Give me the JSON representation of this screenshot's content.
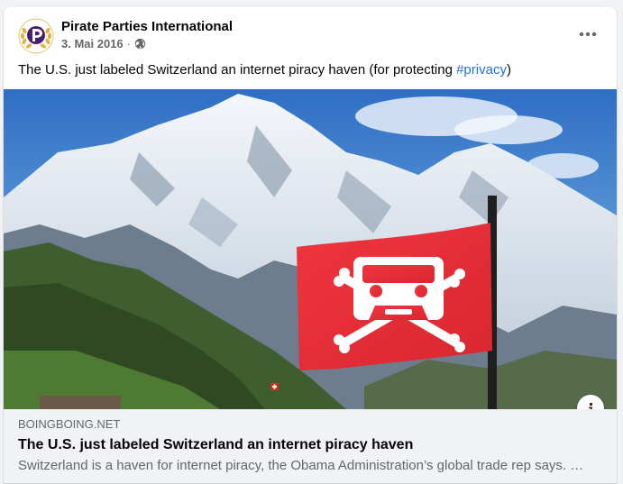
{
  "post": {
    "author": "Pirate Parties International",
    "date": "3. Mai 2016",
    "separator": "·",
    "audience_icon": "globe-icon",
    "text_before": "The U.S. just labeled Switzerland an internet piracy haven (for protecting ",
    "hashtag": "#privacy",
    "text_after": ")"
  },
  "link_preview": {
    "domain": "BOINGBOING.NET",
    "title": "The U.S. just labeled Switzerland an internet piracy haven",
    "description": "Switzerland is a haven for internet piracy, the Obama Administration’s global trade rep says. …"
  },
  "colors": {
    "background": "#f0f2f5",
    "card": "#ffffff",
    "text_primary": "#050505",
    "text_secondary": "#65676b",
    "link": "#216fdb",
    "flag_red": "#e8323c",
    "pirate_purple": "#4b1d6b"
  },
  "icons": {
    "avatar": "pirate-party-logo",
    "more": "more-options-icon",
    "info": "info-icon"
  }
}
